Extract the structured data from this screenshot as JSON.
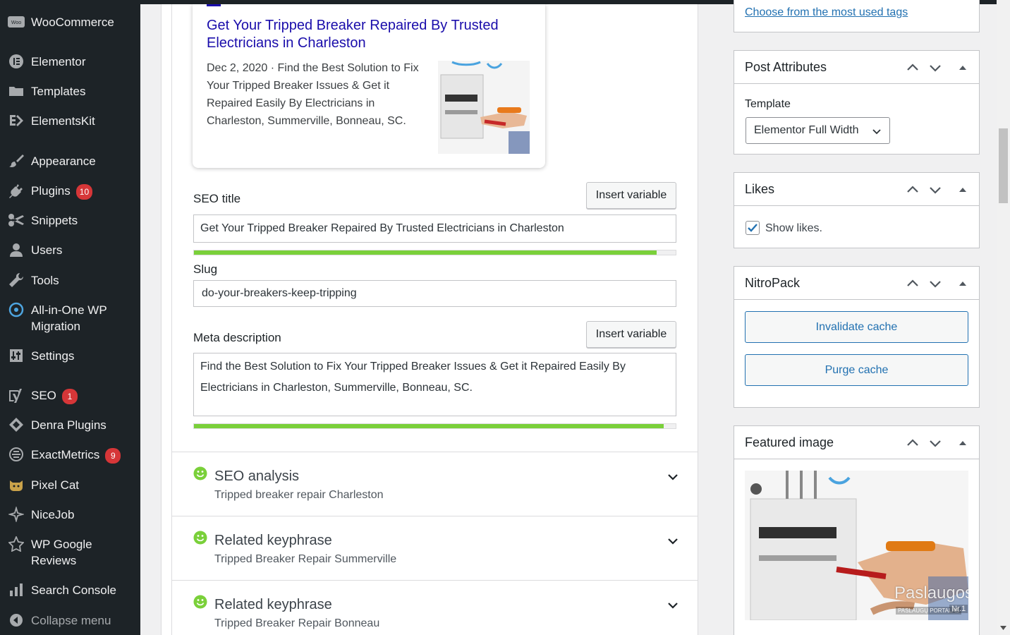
{
  "sidebar": {
    "items": [
      {
        "label": "WooCommerce",
        "icon": "woocommerce-icon",
        "badge": null
      },
      {
        "label": "Elementor",
        "icon": "elementor-icon",
        "badge": null
      },
      {
        "label": "Templates",
        "icon": "folder-icon",
        "badge": null
      },
      {
        "label": "ElementsKit",
        "icon": "elementskit-icon",
        "badge": null
      },
      {
        "label": "Appearance",
        "icon": "paintbrush-icon",
        "badge": null
      },
      {
        "label": "Plugins",
        "icon": "plug-icon",
        "badge": "10"
      },
      {
        "label": "Snippets",
        "icon": "snippets-icon",
        "badge": null
      },
      {
        "label": "Users",
        "icon": "user-icon",
        "badge": null
      },
      {
        "label": "Tools",
        "icon": "wrench-icon",
        "badge": null
      },
      {
        "label": "All-in-One WP Migration",
        "icon": "migration-icon",
        "badge": null
      },
      {
        "label": "Settings",
        "icon": "settings-icon",
        "badge": null
      },
      {
        "label": "SEO",
        "icon": "yoast-icon",
        "badge": "1"
      },
      {
        "label": "Denra Plugins",
        "icon": "denra-icon",
        "badge": null
      },
      {
        "label": "ExactMetrics",
        "icon": "exactmetrics-icon",
        "badge": "9"
      },
      {
        "label": "Pixel Cat",
        "icon": "pixelcat-icon",
        "badge": null
      },
      {
        "label": "NiceJob",
        "icon": "nicejob-icon",
        "badge": null
      },
      {
        "label": "WP Google Reviews",
        "icon": "star-icon",
        "badge": null
      },
      {
        "label": "Search Console",
        "icon": "bar-chart-icon",
        "badge": null
      },
      {
        "label": "Collapse menu",
        "icon": "collapse-icon",
        "badge": null
      }
    ]
  },
  "preview": {
    "title": "Get Your Tripped Breaker Repaired By Trusted Electricians in Charleston",
    "description": "Dec 2, 2020 · Find the Best Solution to Fix Your Tripped Breaker Issues & Get it Repaired Easily By Electricians in Charleston, Summerville, Bonneau, SC."
  },
  "seo_title": {
    "label": "SEO title",
    "insert_label": "Insert variable",
    "value": "Get Your Tripped Breaker Repaired By Trusted Electricians in Charleston",
    "progress": 0.96
  },
  "slug": {
    "label": "Slug",
    "value": "do-your-breakers-keep-tripping"
  },
  "meta": {
    "label": "Meta description",
    "insert_label": "Insert variable",
    "value": "Find the Best Solution to Fix Your Tripped Breaker Issues & Get it Repaired Easily By Electricians in Charleston, Summerville, Bonneau, SC.",
    "progress": 0.975
  },
  "sections": [
    {
      "title": "SEO analysis",
      "subtitle": "Tripped breaker repair Charleston"
    },
    {
      "title": "Related keyphrase",
      "subtitle": "Tripped Breaker Repair Summerville"
    },
    {
      "title": "Related keyphrase",
      "subtitle": "Tripped Breaker Repair Bonneau"
    }
  ],
  "tags": {
    "link": "Choose from the most used tags"
  },
  "post_attributes": {
    "title": "Post Attributes",
    "template_label": "Template",
    "template_value": "Elementor Full Width"
  },
  "likes": {
    "title": "Likes",
    "checkbox_label": "Show likes.",
    "checked": true
  },
  "nitropack": {
    "title": "NitroPack",
    "invalidate": "Invalidate cache",
    "purge": "Purge cache"
  },
  "featured": {
    "title": "Featured image",
    "watermark": "Paslaugos.lt",
    "watermark_sub": "PASLAUGŲ PORTALAS",
    "watermark_nr": "Nr.1"
  },
  "colors": {
    "sidebar_bg": "#1d2327",
    "link": "#2271b1",
    "badge": "#d63638",
    "progress_good": "#7ad03a",
    "google_title": "#1a0dab"
  }
}
